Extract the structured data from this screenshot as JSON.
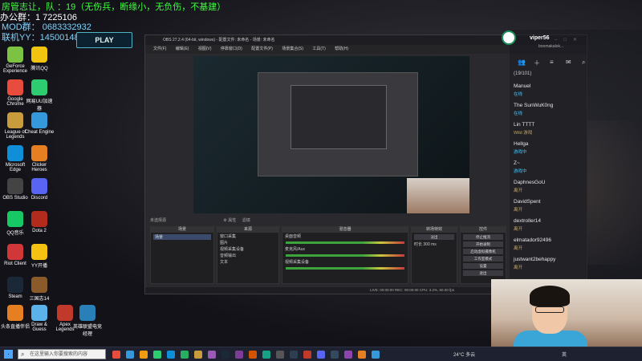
{
  "overlay": {
    "line1": "房管志让，队  ：19（无伤兵，断缘小，无负伤，不基建）",
    "line2": "办公群：1  7225106",
    "line3": "MOD群：  0683332932",
    "line4": "联机YY：14500148562"
  },
  "league": {
    "play_label": "PLAY"
  },
  "desktop_icons": [
    "GeForce Experience",
    "腾讯QQ",
    "Google Chrome",
    "网易UU加速器",
    "League of Legends",
    "Cheat Engine",
    "Microsoft Edge",
    "Clicker Heroes",
    "OBS Studio",
    "Discord",
    "QQ音乐",
    "Dota 2",
    "Riot Client",
    "YY开播",
    "Steam",
    "三国志14",
    "头条直播伴侣",
    "Draw & Guess",
    "Apex Legends",
    "英雄联盟电竞经理"
  ],
  "obs": {
    "title": "OBS 27.2.4 (64-bit, windows) - 配置文件: 未命名 - 场景: 未命名",
    "menu": [
      "文件(F)",
      "编辑(E)",
      "视图(V)",
      "停靠窗口(D)",
      "配置文件(P)",
      "场景集合(S)",
      "工具(T)",
      "帮助(H)"
    ],
    "scene_status": "未选择源",
    "props_label": "属性",
    "filters_label": "滤镜",
    "docks": {
      "scenes_title": "场景",
      "sources_title": "来源",
      "mixer_title": "混音器",
      "transitions_title": "转场特效",
      "controls_title": "控件"
    },
    "scenes": [
      "场景"
    ],
    "sources": [
      "窗口采集",
      "图片",
      "视频采集设备",
      "音频输出",
      "文本"
    ],
    "mixer": [
      {
        "name": "桌面音频",
        "db": "0.0 dB"
      },
      {
        "name": "麦克风/Aux",
        "db": "0.0 dB"
      },
      {
        "name": "视频采集设备",
        "db": "0.0 dB"
      }
    ],
    "transitions": {
      "type": "淡出",
      "duration_label": "时长",
      "duration": "300 ms"
    },
    "controls": [
      "停止推流",
      "开始录制",
      "启动虚拟摄像机",
      "工作室模式",
      "设置",
      "退出"
    ],
    "status": "LIVE: 00:00:00   REC: 00:00:00   CPU: 3.2%, 60.00 fps"
  },
  "sidebar": {
    "username": "viper56",
    "subtext": "boomakalok...",
    "friends_header": "(19/101)",
    "friends": [
      {
        "name": "Manuel",
        "status": "在线",
        "ingame": false
      },
      {
        "name": "The SunWuK0ng",
        "status": "在线",
        "ingame": false
      },
      {
        "name": "Lin TTTT",
        "status": "Wild 游戏",
        "ingame": true
      },
      {
        "name": "Hellga",
        "status": "游戏中",
        "ingame": false
      },
      {
        "name": "Z~",
        "status": "游戏中",
        "ingame": false
      },
      {
        "name": "DaphnesGoU",
        "status": "离开",
        "ingame": true
      },
      {
        "name": "DavidSpent",
        "status": "离开",
        "ingame": true
      },
      {
        "name": "dextroller14",
        "status": "离开",
        "ingame": true
      },
      {
        "name": "elmatador92496",
        "status": "离开",
        "ingame": true
      },
      {
        "name": "justwant2behappy",
        "status": "离开",
        "ingame": true
      }
    ]
  },
  "taskbar": {
    "search_placeholder": "在这里输入你要搜索的内容",
    "weather": "24°C 多云",
    "lang": "英"
  },
  "colors": {
    "overlay_green": "#40ff40",
    "overlay_blue": "#7fd3ff",
    "accent": "#4fb4c4"
  }
}
